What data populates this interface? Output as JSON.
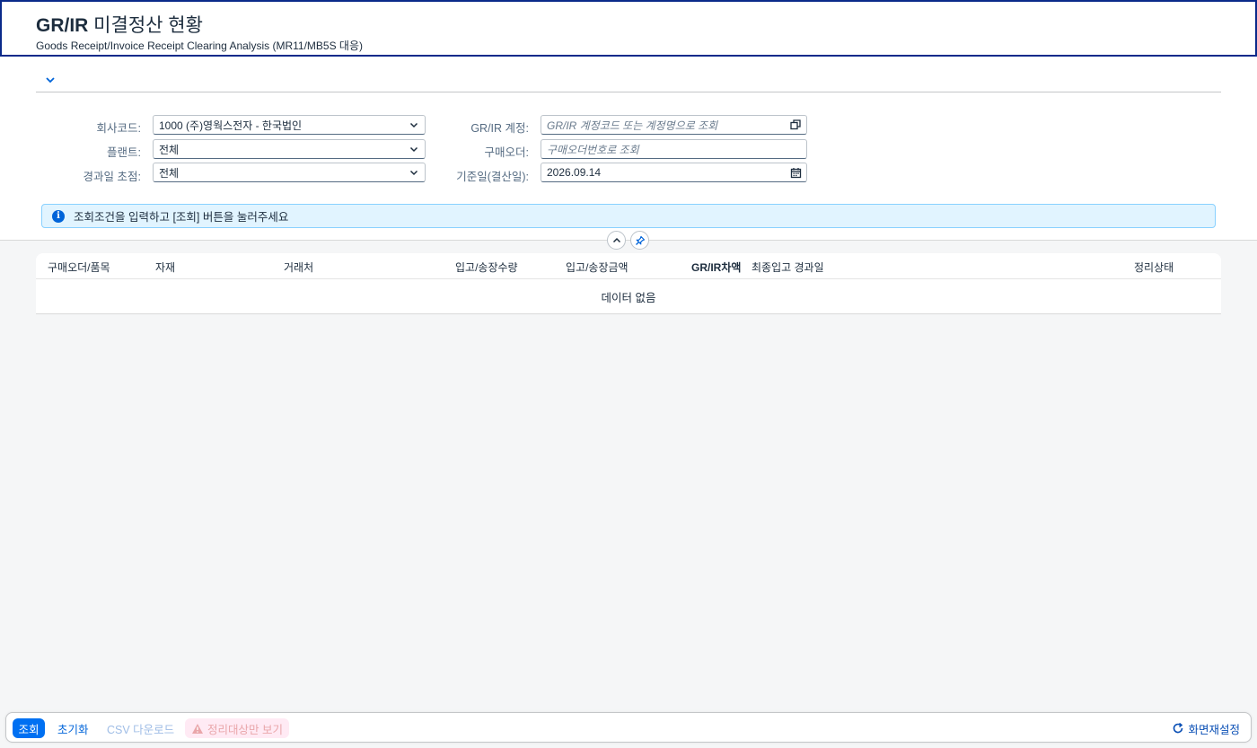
{
  "header": {
    "title_bold": "GR/IR",
    "title_rest": " 미결정산 현황",
    "subtitle": "Goods Receipt/Invoice Receipt Clearing Analysis (MR11/MB5S 대응)"
  },
  "filters": {
    "company_code": {
      "label": "회사코드:",
      "value": "1000 (주)영웍스전자 - 한국법인"
    },
    "plant": {
      "label": "플랜트:",
      "value": "전체"
    },
    "aging_focus": {
      "label": "경과일 초점:",
      "value": "전체"
    },
    "grir_account": {
      "label": "GR/IR 계정:",
      "placeholder": "GR/IR 계정코드 또는 계정명으로 조회"
    },
    "purchase_order": {
      "label": "구매오더:",
      "placeholder": "구매오더번호로 조회"
    },
    "key_date": {
      "label": "기준일(결산일):",
      "value": "2026.09.14"
    }
  },
  "message": {
    "text": "조회조건을 입력하고 [조회] 버튼을 눌러주세요",
    "icon": "info-icon"
  },
  "table": {
    "columns": [
      "구매오더/품목",
      "자재",
      "거래처",
      "입고/송장수량",
      "입고/송장금액",
      "GR/IR차액",
      "최종입고 경과일",
      "정리상태"
    ],
    "no_data": "데이터 없음"
  },
  "footer": {
    "search": "조회",
    "reset": "초기화",
    "csv": "CSV 다운로드",
    "clearing_only": "정리대상만 보기",
    "refresh": "화면재설정"
  },
  "colors": {
    "accent": "#0070f2",
    "header_border": "#0a2a8a",
    "info_bg": "#e1f4ff"
  }
}
